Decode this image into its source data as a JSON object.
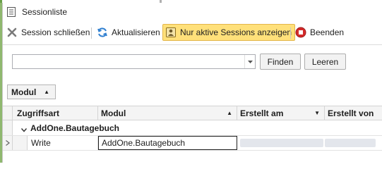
{
  "window": {
    "title": "Sessionliste"
  },
  "toolbar": {
    "close_session": "Session schließen",
    "refresh": "Aktualisieren",
    "active_only": "Nur aktive Sessions anzeigen",
    "quit": "Beenden"
  },
  "search": {
    "value": "",
    "find_label": "Finden",
    "clear_label": "Leeren"
  },
  "group_panel": {
    "chip_label": "Modul",
    "chip_sort": "ascending"
  },
  "grid": {
    "columns": [
      {
        "label": "Zugriffsart",
        "sort": ""
      },
      {
        "label": "Modul",
        "sort": "ascending"
      },
      {
        "label": "Erstellt am",
        "sort": "descending"
      },
      {
        "label": "Erstellt von",
        "sort": ""
      }
    ],
    "group": {
      "label": "AddOne.Bautagebuch",
      "expanded": true
    },
    "rows": [
      {
        "zugriffsart": "Write",
        "modul": "AddOne.Bautagebuch",
        "erstellt_am": "",
        "erstellt_von": ""
      }
    ]
  },
  "colors": {
    "active_toggle_bg": "#ffe07a",
    "refresh_icon": "#2f7fd0",
    "quit_icon": "#d42a2a"
  }
}
